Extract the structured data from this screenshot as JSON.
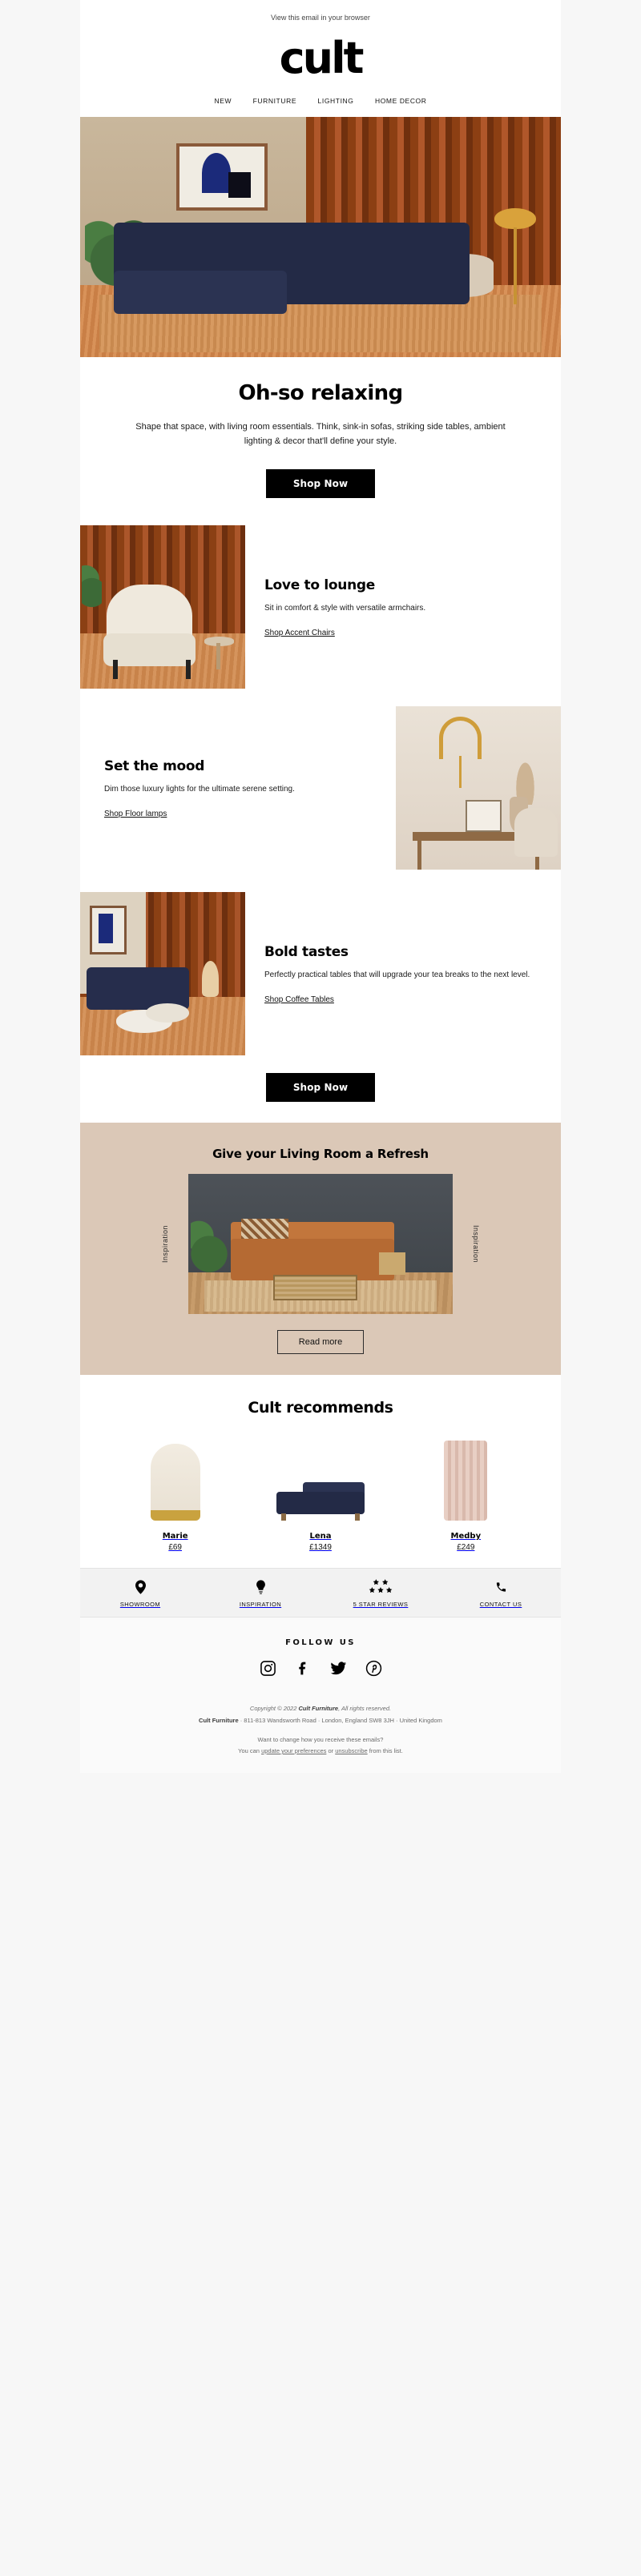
{
  "preheader": {
    "text": "View this email in your browser"
  },
  "brand": {
    "logo": "cult",
    "name": "Cult Furniture"
  },
  "nav": {
    "items": [
      {
        "label": "NEW"
      },
      {
        "label": "FURNITURE"
      },
      {
        "label": "LIGHTING"
      },
      {
        "label": "HOME DECOR"
      }
    ]
  },
  "hero": {
    "alt": "Navy corner sofa in a living room with rust curtains and abstract wall art"
  },
  "intro": {
    "heading": "Oh-so relaxing",
    "body": "Shape that space, with living room essentials. Think, sink-in sofas, striking side tables, ambient lighting & decor that'll define your style.",
    "cta": "Shop Now"
  },
  "features": [
    {
      "title": "Love to lounge",
      "body": "Sit in comfort & style with versatile armchairs.",
      "link": "Shop Accent Chairs",
      "image_alt": "Cream bouclé armchair beside a small side table",
      "image_side": "left"
    },
    {
      "title": "Set the mood",
      "body": "Dim those luxury lights for the ultimate serene setting.",
      "link": "Shop Floor lamps",
      "image_alt": "Console table with arc floor lamp and dried pampas",
      "image_side": "right"
    },
    {
      "title": "Bold tastes",
      "body": "Perfectly practical tables that will upgrade your tea breaks to the next level.",
      "link": "Shop Coffee Tables",
      "image_alt": "Navy sofa with round nesting coffee tables",
      "image_side": "left"
    }
  ],
  "mid_cta": {
    "label": "Shop Now"
  },
  "inspiration": {
    "heading": "Give your Living Room a Refresh",
    "side_label_left": "Inspiration",
    "side_label_right": "Inspiration",
    "cta": "Read more",
    "background_color": "#dbc8b7",
    "image_alt": "Tan leather bench with woven trunk and plants against a dark wall"
  },
  "recommends": {
    "heading": "Cult recommends",
    "products": [
      {
        "name": "Marie",
        "price": "£69",
        "image_alt": "Cream table lamp with gold base"
      },
      {
        "name": "Lena",
        "price": "£1349",
        "image_alt": "Navy corner sofa"
      },
      {
        "name": "Medby",
        "price": "£249",
        "image_alt": "Fluted blush pink side table"
      }
    ]
  },
  "usps": [
    {
      "icon": "location-pin-icon",
      "label": "SHOWROOM"
    },
    {
      "icon": "lightbulb-icon",
      "label": "INSPIRATION"
    },
    {
      "icon": "stars-icon",
      "label": "5 STAR REVIEWS"
    },
    {
      "icon": "phone-icon",
      "label": "CONTACT US"
    }
  ],
  "footer": {
    "follow_heading": "FOLLOW US",
    "social": [
      {
        "icon": "instagram-icon",
        "label": "Instagram"
      },
      {
        "icon": "facebook-icon",
        "label": "Facebook"
      },
      {
        "icon": "twitter-icon",
        "label": "Twitter"
      },
      {
        "icon": "pinterest-icon",
        "label": "Pinterest"
      }
    ],
    "copyright_prefix": "Copyright © 2022",
    "copyright_brand": "Cult Furniture",
    "copyright_suffix": ", All rights reserved.",
    "address_brand": "Cult Furniture",
    "address_rest": " · 811-813 Wandsworth Road · London, England SW8 3JH · United Kingdom",
    "prefs_line": "Want to change how you receive these emails?",
    "prefs_prefix": "You can ",
    "prefs_link1": "update your preferences",
    "prefs_middle": " or ",
    "prefs_link2": "unsubscribe",
    "prefs_suffix": " from this list."
  }
}
